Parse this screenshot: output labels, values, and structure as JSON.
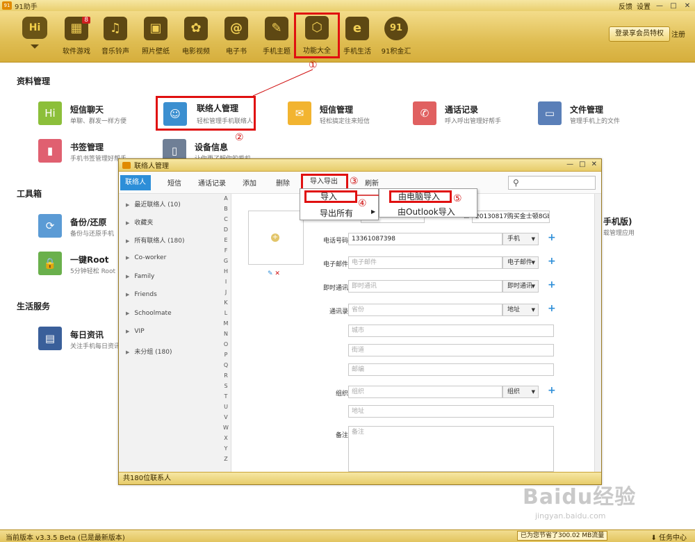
{
  "app": {
    "title": "91助手",
    "logo": "91"
  },
  "titlebar": {
    "feedback": "反馈",
    "settings": "设置",
    "minimize": "—",
    "restore": "□",
    "close": "✕"
  },
  "toolbar": {
    "hi_logo": "Hi",
    "items": [
      {
        "label": "软件游戏",
        "icon": "apps-icon",
        "glyph": "▦",
        "badge": "8"
      },
      {
        "label": "音乐铃声",
        "icon": "music-icon",
        "glyph": "♫"
      },
      {
        "label": "照片壁纸",
        "icon": "photo-icon",
        "glyph": "▣"
      },
      {
        "label": "电影视频",
        "icon": "film-reel-icon",
        "glyph": "✿"
      },
      {
        "label": "电子书",
        "icon": "ebook-icon",
        "glyph": "@"
      },
      {
        "label": "手机主题",
        "icon": "paint-palette-icon",
        "glyph": "✎"
      },
      {
        "label": "功能大全",
        "icon": "box-icon",
        "glyph": "⬡"
      },
      {
        "label": "手机生活",
        "icon": "basket-icon",
        "glyph": "e"
      },
      {
        "label": "91积金汇",
        "icon": "coin-icon",
        "glyph": "91"
      }
    ],
    "vip_button": "登录享会员特权",
    "register": "注册"
  },
  "sections": {
    "data_mgmt": "资料管理",
    "toolbox": "工具箱",
    "life": "生活服务"
  },
  "features": {
    "sms_chat": {
      "name": "短信聊天",
      "desc": "单聊、群发一样方便",
      "glyph": "Hi",
      "color": "#8cbf3a"
    },
    "contacts": {
      "name": "联络人管理",
      "desc": "轻松管理手机联络人",
      "glyph": "☺",
      "color": "#3b8fd0"
    },
    "sms_mgmt": {
      "name": "短信管理",
      "desc": "轻松搞定往来短信",
      "glyph": "✉",
      "color": "#f2b430"
    },
    "call_log": {
      "name": "通话记录",
      "desc": "呼入呼出管理好帮手",
      "glyph": "✆",
      "color": "#e06060"
    },
    "file_mgmt": {
      "name": "文件管理",
      "desc": "管理手机上的文件",
      "glyph": "▭",
      "color": "#5a7fb8"
    },
    "bookmark": {
      "name": "书签管理",
      "desc": "手机书签管理好帮手",
      "glyph": "▮",
      "color": "#e06070"
    },
    "device_info": {
      "name": "设备信息",
      "desc": "让你更了解你的爱机",
      "glyph": "▯",
      "color": "#6f7f96"
    },
    "backup": {
      "name": "备份/还原",
      "desc": "备份与还原手机",
      "glyph": "⟳",
      "color": "#5b9bd5"
    },
    "root": {
      "name": "一键Root",
      "desc": "5分钟轻松 Root",
      "glyph": "🔒",
      "color": "#6ab04c"
    },
    "news": {
      "name": "每日资讯",
      "desc": "关注手机每日资讯",
      "glyph": "▤",
      "color": "#3a5f9a"
    },
    "phone_edition_partial": "手机版)",
    "phone_edition_desc": "载管理应用"
  },
  "annotations": [
    "①",
    "②",
    "③",
    "④",
    "⑤"
  ],
  "dialog": {
    "title": "联络人管理",
    "tabs": {
      "contacts": "联络人",
      "sms": "短信",
      "call_log": "通话记录",
      "add": "添加",
      "delete": "删除",
      "import_export": "导入导出",
      "refresh": "刷新"
    },
    "groups": [
      "最近联络人 (10)",
      "收藏夹",
      "所有联络人 (180)",
      "Co-worker",
      "Family",
      "Friends",
      "Schoolmate",
      "VIP",
      "未分组 (180)"
    ],
    "letters": [
      "A",
      "B",
      "C",
      "D",
      "E",
      "F",
      "G",
      "H",
      "I",
      "J",
      "K",
      "L",
      "M",
      "N",
      "O",
      "P",
      "Q",
      "R",
      "S",
      "T",
      "U",
      "V",
      "W",
      "X",
      "Y",
      "Z"
    ],
    "form": {
      "name_value": "20130817购买金士顿8Gb",
      "phone_label": "电话号码",
      "phone_value": "13361087398",
      "phone_type": "手机",
      "email_label": "电子邮件",
      "email_placeholder": "电子邮件",
      "email_type": "电子邮件",
      "im_label": "即时通讯",
      "im_placeholder": "即时通讯",
      "im_type": "即时通讯",
      "address_label": "通讯录",
      "province_placeholder": "省份",
      "address_type": "地址",
      "city_placeholder": "城市",
      "street_placeholder": "街道",
      "zip_placeholder": "邮编",
      "org_label": "组织",
      "org_placeholder": "组织",
      "org_type": "组织",
      "org_address_placeholder": "地址",
      "note_label": "备注",
      "note_placeholder": "备注"
    },
    "status": "共180位联系人"
  },
  "menu": {
    "import": "导入",
    "export_all": "导出所有",
    "from_pc": "由电脑导入",
    "from_outlook": "由Outlook导入"
  },
  "statusbar": {
    "version": "当前版本 v3.3.5 Beta (已是最新版本)",
    "saved": "已为您节省了300.02 MB流量",
    "task_center": "任务中心"
  },
  "watermark": {
    "brand": "Baidu经验",
    "url": "jingyan.baidu.com"
  }
}
